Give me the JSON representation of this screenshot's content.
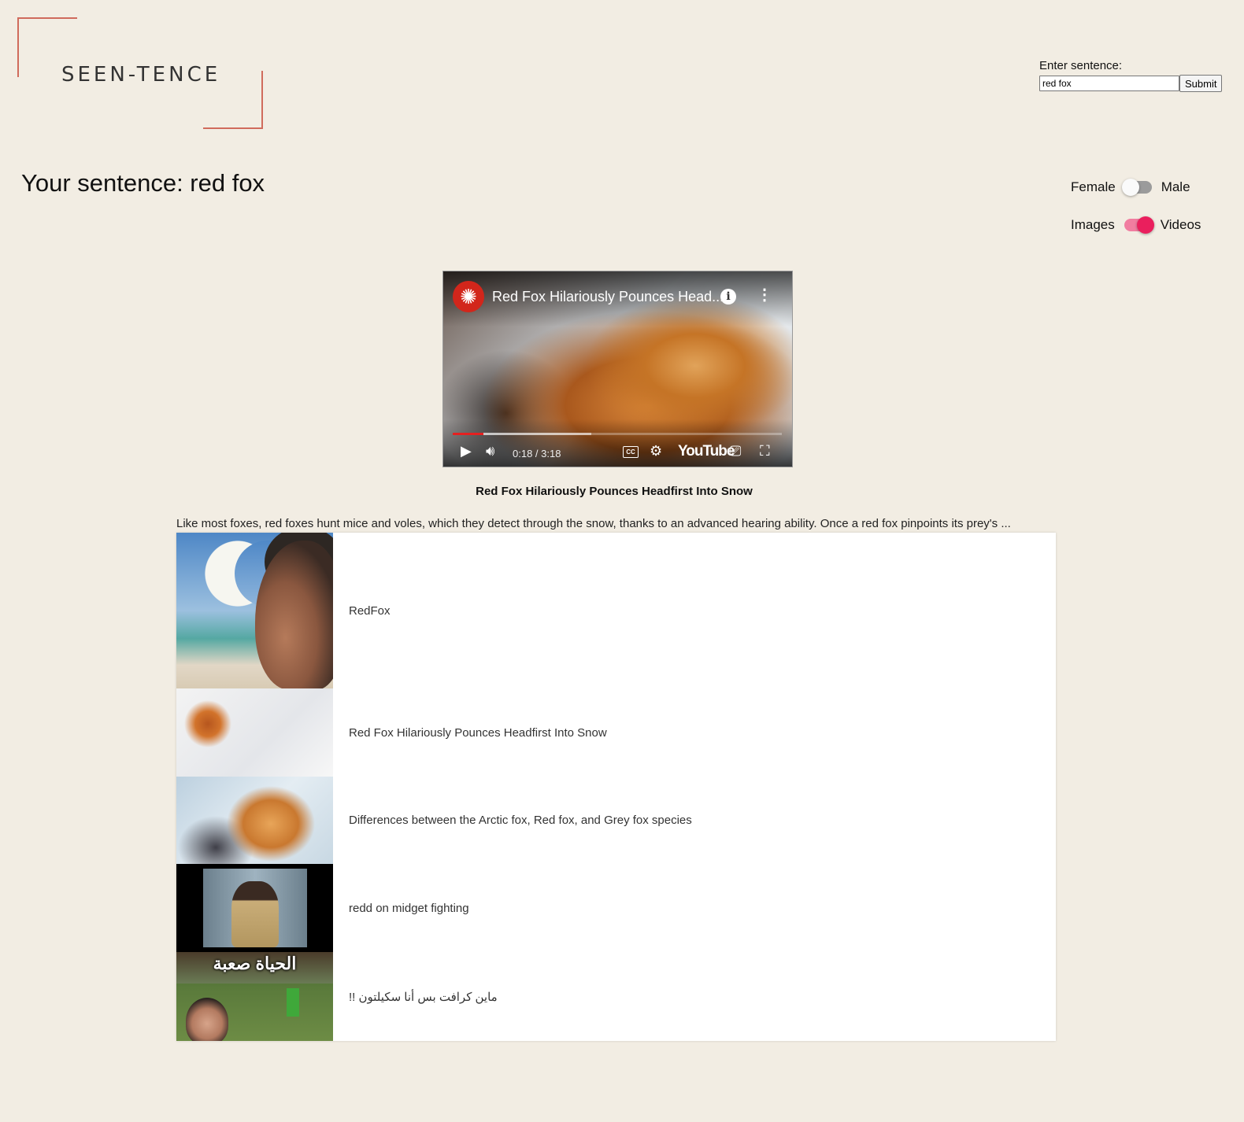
{
  "logo": {
    "text": "SEEN-TENCE"
  },
  "form": {
    "label": "Enter sentence:",
    "input_value": "red fox",
    "submit_label": "Submit"
  },
  "heading": "Your sentence: red fox",
  "toggles": {
    "voice": {
      "left": "Female",
      "right": "Male",
      "selected": "Female"
    },
    "media": {
      "left": "Images",
      "right": "Videos",
      "selected": "Videos"
    }
  },
  "colors": {
    "background": "#f2ede3",
    "logo_accent": "#d06b5c",
    "toggle_on": "#ea1f5d"
  },
  "video": {
    "title": "Red Fox Hilariously Pounces Head...",
    "time": "0:18 / 3:18",
    "played_fraction": 0.094,
    "buffered_fraction": 0.42,
    "brand": "YouTube",
    "cc": "CC",
    "icons": [
      "channel-logo-icon",
      "info-icon",
      "more-icon",
      "play-icon",
      "volume-icon",
      "captions-icon",
      "settings-icon",
      "cast-icon",
      "fullscreen-icon"
    ]
  },
  "video_caption": "Red Fox Hilariously Pounces Headfirst Into Snow",
  "description": "Like most foxes, red foxes hunt mice and voles, which they detect through the snow, thanks to an advanced hearing ability. Once a red fox pinpoints its prey's ...",
  "results": [
    {
      "label": "RedFox"
    },
    {
      "label": "Red Fox Hilariously Pounces Headfirst Into Snow"
    },
    {
      "label": "Differences between the Arctic fox, Red fox, and Grey fox species"
    },
    {
      "label": "redd on midget fighting"
    },
    {
      "label": "ماين كرافت بس أنا سكيلتون !!",
      "thumb_text": "الحياة صعبة"
    }
  ]
}
